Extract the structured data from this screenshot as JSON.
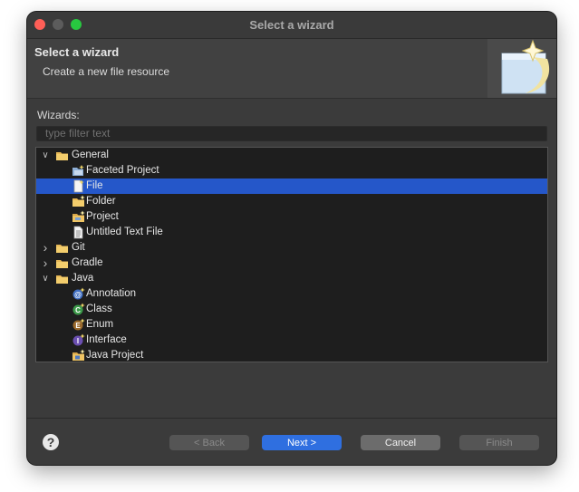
{
  "window": {
    "title": "Select a wizard"
  },
  "header": {
    "title": "Select a wizard",
    "description": "Create a new file resource"
  },
  "wizards_label": "Wizards:",
  "filter": {
    "placeholder": "type filter text",
    "value": ""
  },
  "tree": {
    "items": [
      {
        "label": "General",
        "level": 0,
        "expander": "expanded",
        "icon": "folder-icon"
      },
      {
        "label": "Faceted Project",
        "level": 1,
        "icon": "faceted-project-icon"
      },
      {
        "label": "File",
        "level": 1,
        "icon": "new-file-icon",
        "selected": true
      },
      {
        "label": "Folder",
        "level": 1,
        "icon": "new-folder-icon"
      },
      {
        "label": "Project",
        "level": 1,
        "icon": "new-project-icon"
      },
      {
        "label": "Untitled Text File",
        "level": 1,
        "icon": "text-file-icon"
      },
      {
        "label": "Git",
        "level": 0,
        "expander": "collapsed",
        "icon": "folder-icon"
      },
      {
        "label": "Gradle",
        "level": 0,
        "expander": "collapsed",
        "icon": "folder-icon"
      },
      {
        "label": "Java",
        "level": 0,
        "expander": "expanded",
        "icon": "folder-icon"
      },
      {
        "label": "Annotation",
        "level": 1,
        "icon": "annotation-icon"
      },
      {
        "label": "Class",
        "level": 1,
        "icon": "class-icon"
      },
      {
        "label": "Enum",
        "level": 1,
        "icon": "enum-icon"
      },
      {
        "label": "Interface",
        "level": 1,
        "icon": "interface-icon"
      },
      {
        "label": "Java Project",
        "level": 1,
        "icon": "java-project-icon"
      }
    ]
  },
  "buttons": {
    "help": "?",
    "back": "< Back",
    "next": "Next >",
    "cancel": "Cancel",
    "finish": "Finish"
  },
  "colors": {
    "selection": "#2557c9",
    "primary_button": "#2f6fe0"
  }
}
